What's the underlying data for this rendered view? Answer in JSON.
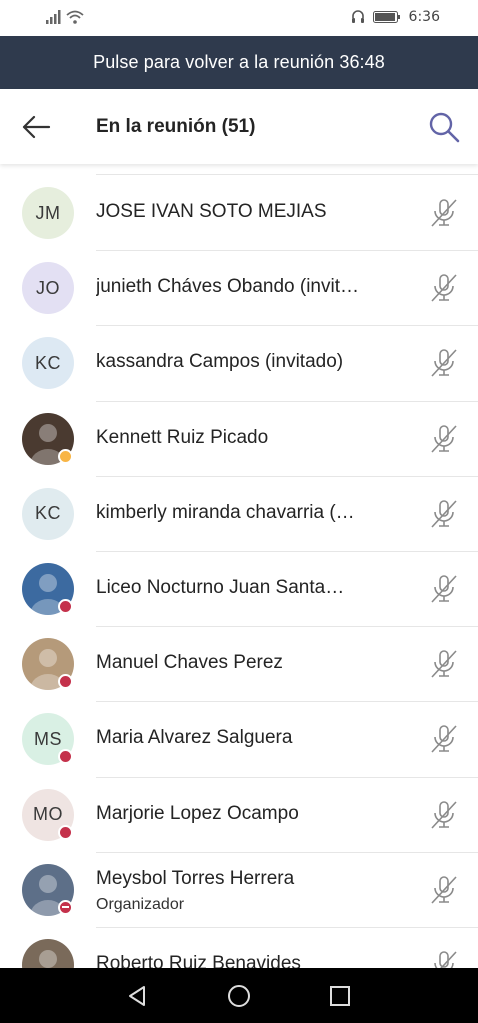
{
  "status_bar": {
    "time": "6:36"
  },
  "banner": {
    "text": "Pulse para volver a la reunión 36:48"
  },
  "header": {
    "title": "En la reunión (51)"
  },
  "participants": [
    {
      "initials": "JM",
      "name": "JOSE IVAN SOTO MEJIAS",
      "avatar_bg": "#e6eedd",
      "status": "none"
    },
    {
      "initials": "JO",
      "name": "junieth Cháves Obando (invit…",
      "avatar_bg": "#e3e0f3",
      "status": "none"
    },
    {
      "initials": "KC",
      "name": "kassandra Campos (invitado)",
      "avatar_bg": "#dde9f3",
      "status": "none"
    },
    {
      "initials": "",
      "name": "Kennett Ruiz Picado",
      "avatar_bg": "#4a3a30",
      "status": "away",
      "photo": true
    },
    {
      "initials": "KC",
      "name": "kimberly miranda chavarria  (…",
      "avatar_bg": "#e0ebef",
      "status": "none"
    },
    {
      "initials": "",
      "name": "Liceo Nocturno Juan Santa…",
      "avatar_bg": "#3c6aa0",
      "status": "busy",
      "photo": true
    },
    {
      "initials": "",
      "name": "Manuel Chaves Perez",
      "avatar_bg": "#b59a7a",
      "status": "busy",
      "photo": true
    },
    {
      "initials": "MS",
      "name": "Maria Alvarez Salguera",
      "avatar_bg": "#d9f0e4",
      "status": "busy"
    },
    {
      "initials": "MO",
      "name": "Marjorie Lopez Ocampo",
      "avatar_bg": "#efe4e2",
      "status": "busy"
    },
    {
      "initials": "",
      "name": "Meysbol Torres Herrera",
      "subtitle": "Organizador",
      "avatar_bg": "#5d6f88",
      "status": "dnd",
      "photo": true
    },
    {
      "initials": "",
      "name": "Roberto Ruiz Benavides",
      "avatar_bg": "#7a6a5a",
      "status": "none",
      "photo": true
    }
  ],
  "colors": {
    "banner_bg": "#2f3a4d",
    "accent": "#6264a7",
    "busy": "#c4314b",
    "away": "#f8b545"
  },
  "icons": {
    "back": "arrow-left-icon",
    "search": "search-icon",
    "mic": "mic-off-icon"
  }
}
